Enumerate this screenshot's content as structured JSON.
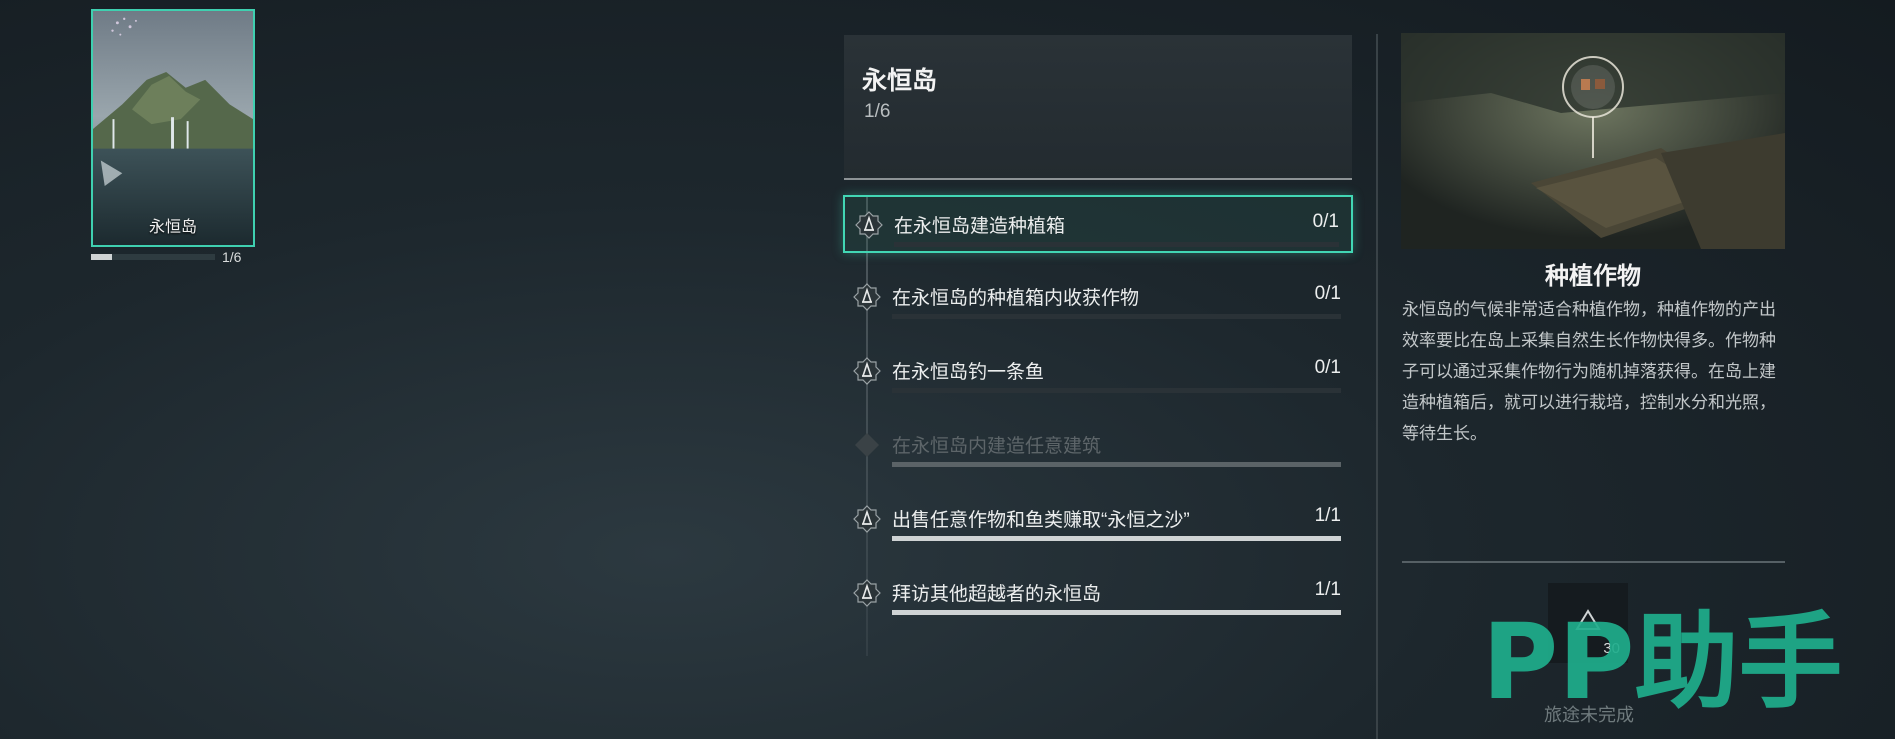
{
  "island_card": {
    "name": "永恒岛",
    "progress_text": "1/6",
    "progress_fraction": 0.1667
  },
  "header": {
    "title": "永恒岛",
    "progress": "1/6"
  },
  "tasks": [
    {
      "label": "在永恒岛建造种植箱",
      "count": "0/1",
      "state": "active",
      "progress": 0
    },
    {
      "label": "在永恒岛的种植箱内收获作物",
      "count": "0/1",
      "state": "normal",
      "progress": 0
    },
    {
      "label": "在永恒岛钓一条鱼",
      "count": "0/1",
      "state": "normal",
      "progress": 0
    },
    {
      "label": "在永恒岛内建造任意建筑",
      "count": "",
      "state": "locked",
      "progress": 1
    },
    {
      "label": "出售任意作物和鱼类赚取“永恒之沙”",
      "count": "1/1",
      "state": "done",
      "progress": 1
    },
    {
      "label": "拜访其他超越者的永恒岛",
      "count": "1/1",
      "state": "done",
      "progress": 1
    }
  ],
  "detail": {
    "title": "种植作物",
    "description": "永恒岛的气候非常适合种植作物，种植作物的产出效率要比在岛上采集自然生长作物快得多。作物种子可以通过采集作物行为随机掉落获得。在岛上建造种植箱后，就可以进行栽培，控制水分和光照，等待生长。"
  },
  "reward": {
    "icon": "triangle-token-icon",
    "count": "30"
  },
  "status": "旅途未完成",
  "watermark": "PP助手",
  "colors": {
    "accent": "#42d6b4",
    "watermark": "#1fae8c"
  }
}
